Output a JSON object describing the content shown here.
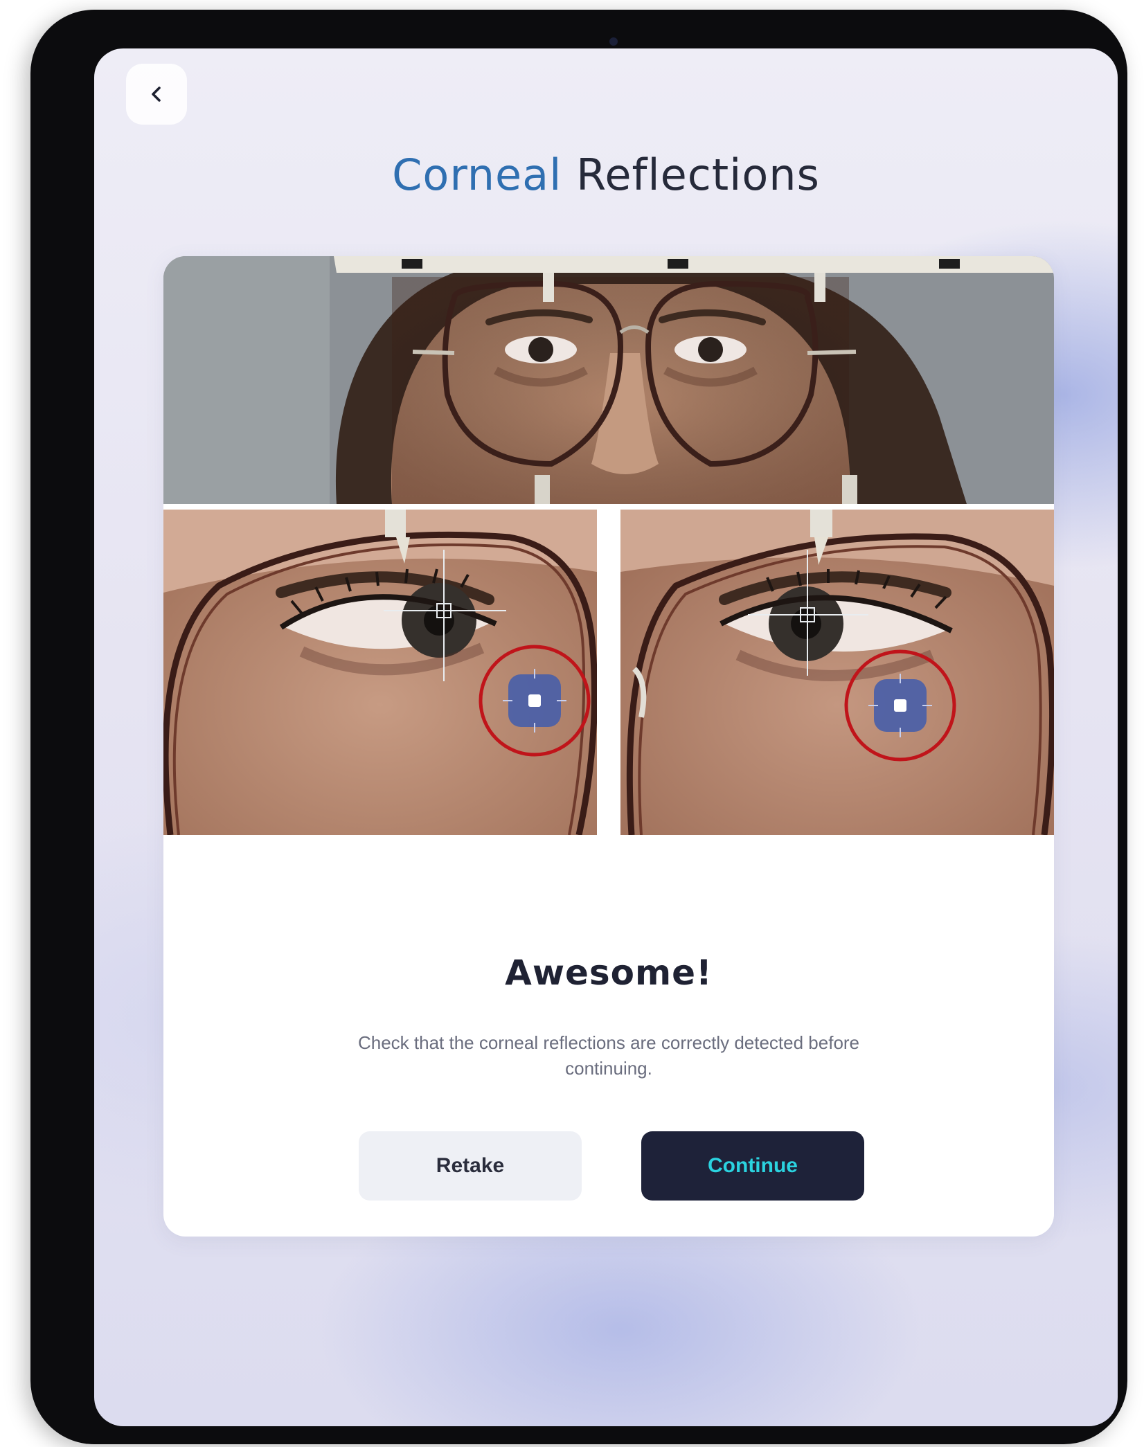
{
  "header": {
    "back_icon": "chevron-left-icon",
    "title_accent": "Corneal",
    "title_rest": " Reflections"
  },
  "result": {
    "headline": "Awesome!",
    "message": "Check that the corneal reflections are correctly detected before continuing."
  },
  "actions": {
    "retake_label": "Retake",
    "continue_label": "Continue"
  },
  "colors": {
    "title_accent": "#2f6fb1",
    "continue_bg": "#1e2239",
    "continue_text": "#2bd3e0",
    "retake_bg": "#eef0f5",
    "highlight_ring": "#c0141a"
  }
}
